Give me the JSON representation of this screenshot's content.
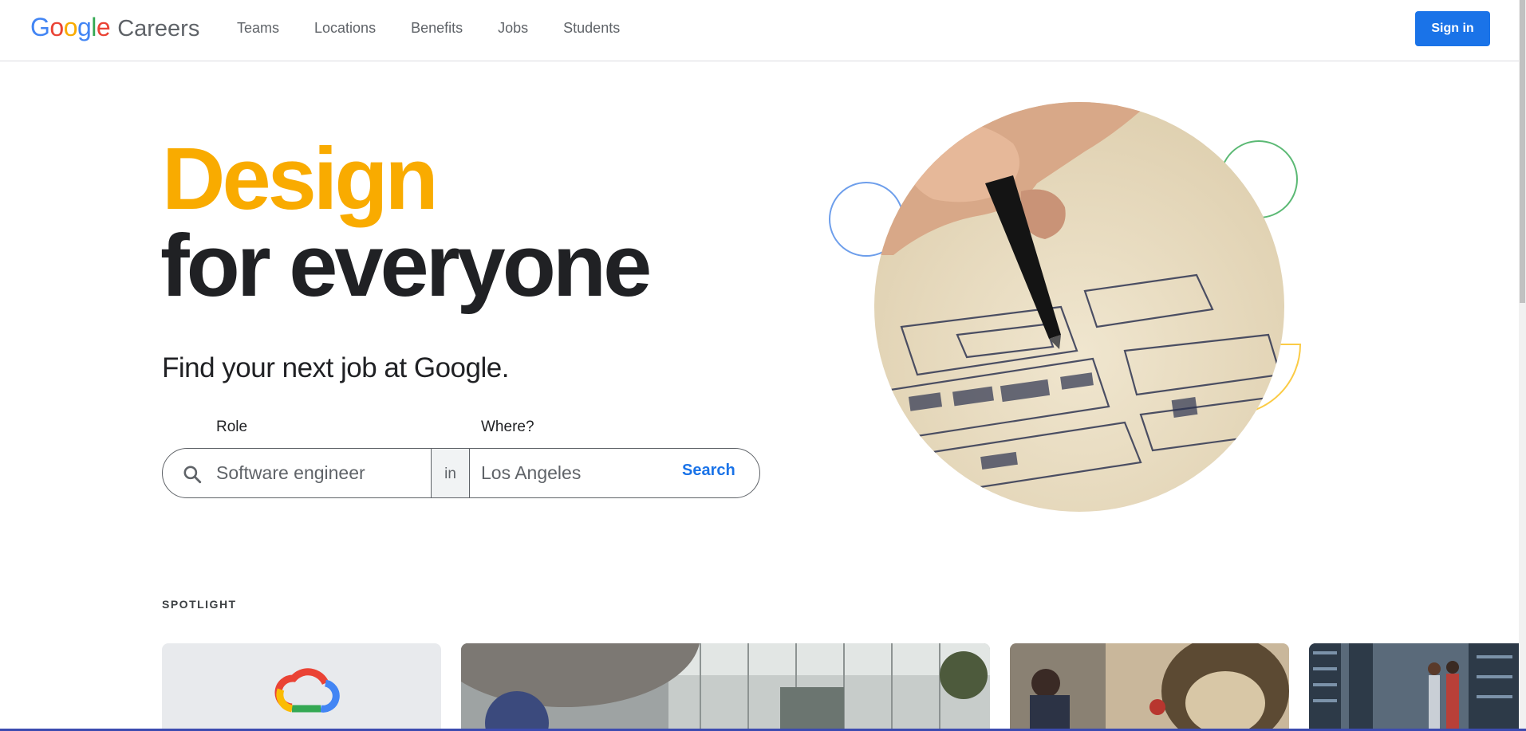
{
  "header": {
    "logo_google": "Google",
    "logo_careers": "Careers",
    "nav": [
      "Teams",
      "Locations",
      "Benefits",
      "Jobs",
      "Students"
    ],
    "signin_label": "Sign in"
  },
  "hero": {
    "title_line1": "Design",
    "title_line2": "for everyone",
    "subtitle": "Find your next job at Google."
  },
  "search": {
    "role_label": "Role",
    "where_label": "Where?",
    "role_value": "Software engineer",
    "in_label": "in",
    "where_value": "Los Angeles",
    "button_label": "Search"
  },
  "spotlight": {
    "heading": "SPOTLIGHT"
  },
  "colors": {
    "accent_blue": "#1a73e8",
    "google_yellow": "#f9ab00",
    "google_green": "#34a853",
    "google_red": "#ea4335",
    "google_blue": "#4285f4"
  },
  "icons": [
    "search-icon",
    "google-cloud-logo-icon"
  ]
}
